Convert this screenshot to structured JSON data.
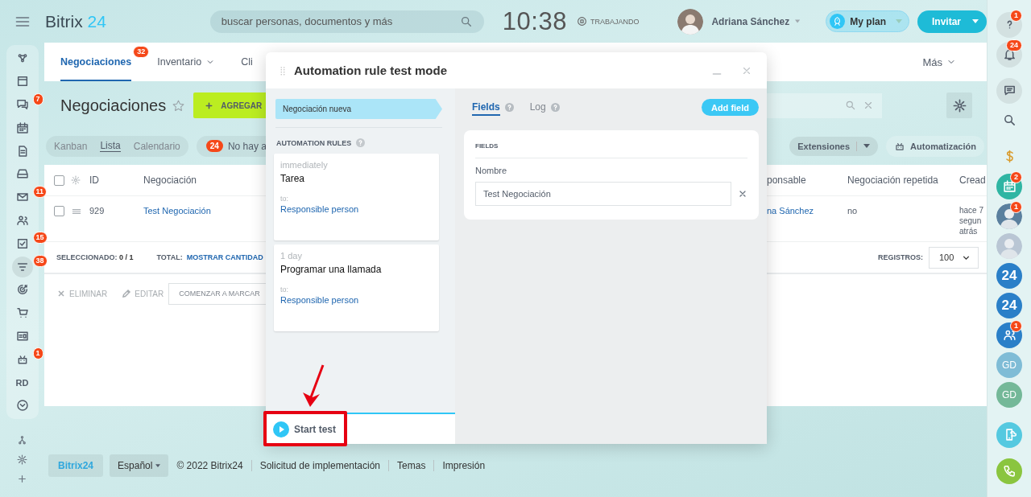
{
  "topbar": {
    "logo": "Bitrix",
    "logo_number": "24",
    "search_placeholder": "buscar personas, documentos y más",
    "clock": "10:38",
    "work_status": "TRABAJANDO",
    "user_name": "Adriana Sánchez",
    "plan_button": "My plan",
    "invite_button": "Invitar"
  },
  "left_nav": [
    {
      "selected": false
    },
    {
      "selected": false
    },
    {
      "selected": false,
      "badge": "7"
    },
    {
      "selected": false
    },
    {
      "selected": false
    },
    {
      "selected": false
    },
    {
      "selected": false,
      "badge": "11"
    },
    {
      "selected": false
    },
    {
      "selected": false,
      "badge": "15"
    },
    {
      "selected": true,
      "badge": "38"
    },
    {
      "selected": false
    },
    {
      "selected": false
    },
    {
      "selected": false
    },
    {
      "selected": false,
      "badge": "1"
    },
    {
      "selected": false,
      "label": "RD"
    },
    {
      "selected": false
    }
  ],
  "left_nav_bottom": [
    {
      "selected": false
    },
    {
      "selected": false
    },
    {
      "selected": false
    }
  ],
  "tabs": [
    {
      "label": "Negociaciones",
      "badge": "32",
      "selected": true,
      "dropdown": false
    },
    {
      "label": "Inventario",
      "selected": false,
      "dropdown": true
    },
    {
      "label": "Cli",
      "selected": false,
      "dropdown": false
    }
  ],
  "more_tab": "Más",
  "page_title": "Negociaciones",
  "add_button": "AGREGAR",
  "views": [
    {
      "label": "Kanban",
      "selected": false
    },
    {
      "label": "Lista",
      "selected": true
    },
    {
      "label": "Calendario",
      "selected": false
    }
  ],
  "activity_counter": {
    "count": "24",
    "text": "No hay a"
  },
  "extensions_button": "Extensiones",
  "automation_button": "Automatización",
  "table": {
    "all_checked": false,
    "columns": [
      "ID",
      "Negociación",
      "ponsable",
      "Negociación repetida",
      "Cread"
    ],
    "rows": [
      {
        "checked": false,
        "cells": [
          "929",
          "Test Negociación",
          "na Sánchez",
          "no",
          "hace 7 segun atrás"
        ]
      }
    ]
  },
  "selection": {
    "label": "SELECCIONADO:",
    "value": "0 / 1"
  },
  "total": {
    "label": "TOTAL:",
    "link": "MOSTRAR CANTIDAD"
  },
  "page_size": {
    "label": "REGISTROS:",
    "value": "100"
  },
  "actions": [
    {
      "kind": "delete",
      "label": "ELIMINAR"
    },
    {
      "kind": "edit",
      "label": "EDITAR"
    }
  ],
  "mark_button": "COMENZAR A MARCAR",
  "footer": {
    "logo": "Bitrix24",
    "language": "Español",
    "copyright": "© 2022 Bitrix24",
    "links": [
      "Solicitud de implementación",
      "Temas",
      "Impresión"
    ]
  },
  "right_bar": [
    {
      "kind": "icon",
      "badge": "1"
    },
    {
      "kind": "icon",
      "badge": "24"
    },
    {
      "kind": "icon"
    },
    {
      "kind": "icon"
    },
    {
      "kind": "icon"
    },
    {
      "kind": "icon",
      "badge": "2"
    },
    {
      "kind": "avatar",
      "badge": "1"
    },
    {
      "kind": "avatar"
    },
    {
      "kind": "logo",
      "label": "24"
    },
    {
      "kind": "logo",
      "label": "24"
    },
    {
      "kind": "icon",
      "badge": "1"
    },
    {
      "kind": "initials",
      "label": "GD",
      "color": "#7fbcd6"
    },
    {
      "kind": "initials",
      "label": "GD",
      "color": "#74b898"
    },
    {
      "kind": "icon"
    },
    {
      "kind": "icon"
    }
  ],
  "modal": {
    "title": "Automation rule test mode",
    "stage": "Negociación nueva",
    "rules_heading": "AUTOMATION RULES",
    "rules": [
      {
        "delay": "immediately",
        "title": "Tarea",
        "to_label": "to:",
        "recipient": "Responsible person"
      },
      {
        "delay": "1 day",
        "title": "Programar una llamada",
        "to_label": "to:",
        "recipient": "Responsible person"
      }
    ],
    "start_button": "Start test",
    "tabs": [
      {
        "label": "Fields",
        "selected": true
      },
      {
        "label": "Log",
        "selected": false
      }
    ],
    "add_field_button": "Add field",
    "fields_heading": "FIELDS",
    "fields": [
      {
        "label": "Nombre",
        "value": "Test Negociación"
      }
    ]
  }
}
